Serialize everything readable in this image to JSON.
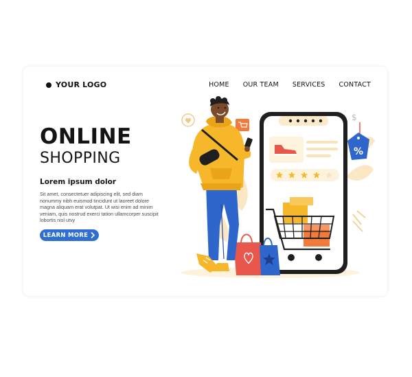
{
  "header": {
    "logo_text": "YOUR LOGO",
    "nav": [
      "HOME",
      "OUR TEAM",
      "SERVICES",
      "CONTACT"
    ]
  },
  "hero": {
    "title_line1": "ONLINE",
    "title_line2": "SHOPPING",
    "subtitle": "Lorem ipsum dolor",
    "body": "Sit amet, consectetuer adipiscing elit, sed diam nonummy nibh euismod tincidunt ut laoreet dolore magna aliquam erat volutpat. Ut wisi enim ad minim veniam, quis nostrud exerci tation ullamcorper suscipit lobortis nisl utvy",
    "cta_label": "LEARN MORE",
    "cta_icon": "chevron-right-icon"
  },
  "illustration": {
    "discount_tag_text": "%",
    "rating_stars": 4,
    "rating_max": 5
  },
  "colors": {
    "accent": "#2f6fd1",
    "yellow": "#f6b72b",
    "orange": "#f27b3c",
    "red_bag": "#e8574b",
    "blue_bag": "#2f66cc",
    "phone_frame": "#1f1f1f",
    "pale_yellow": "#fdf3dc"
  }
}
